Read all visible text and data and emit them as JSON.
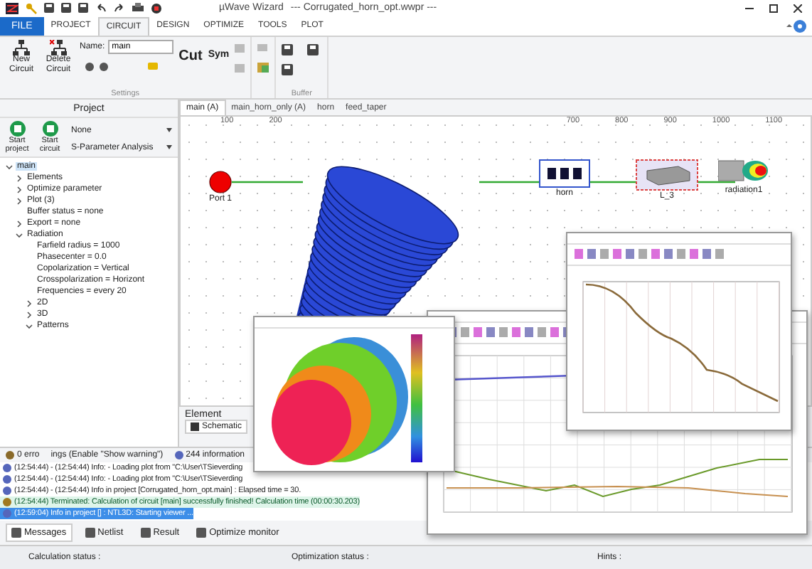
{
  "window": {
    "title": "µWave Wizard",
    "file": "--- Corrugated_horn_opt.wwpr ---"
  },
  "file_tab": "FILE",
  "ribbon_tabs": [
    {
      "label": "PROJECT",
      "selected": false
    },
    {
      "label": "CIRCUIT",
      "selected": true
    },
    {
      "label": "DESIGN",
      "selected": false
    },
    {
      "label": "OPTIMIZE",
      "selected": false
    },
    {
      "label": "TOOLS",
      "selected": false
    },
    {
      "label": "PLOT",
      "selected": false
    }
  ],
  "ribbon": {
    "new_button": "New Circuit",
    "delete_button": "Delete Circuit",
    "name_label": "Name:",
    "name_value": "main",
    "cut_button": "Cut",
    "sym_button": "Sym",
    "groups": [
      "Settings",
      "Buffer"
    ]
  },
  "project": {
    "title": "Project",
    "start_project": "Start project",
    "start_circuit": "Start circuit",
    "mode": "None",
    "analysis": "S-Parameter Analysis",
    "tree": [
      {
        "label": "main",
        "selected": true,
        "expanded": true,
        "children": [
          {
            "label": "Elements",
            "selected": false,
            "expanded": false
          },
          {
            "label": "Optimize parameter",
            "selected": false,
            "expanded": false
          },
          {
            "label": "Plot (3)",
            "selected": false,
            "expanded": false
          },
          {
            "label": "Buffer status = none",
            "selected": false
          },
          {
            "label": "Export = none",
            "selected": false,
            "expanded": false
          },
          {
            "label": "Radiation",
            "selected": false,
            "expanded": true,
            "children": [
              {
                "label": "Farfield radius = 1000",
                "selected": false
              },
              {
                "label": "Phasecenter = 0.0",
                "selected": false
              },
              {
                "label": "Copolarization = Vertical",
                "selected": false
              },
              {
                "label": "Crosspolarization = Horizont",
                "selected": false
              },
              {
                "label": "Frequencies = every 20",
                "selected": false
              },
              {
                "label": "2D",
                "selected": false,
                "expanded": false
              },
              {
                "label": "3D",
                "selected": false,
                "expanded": false
              },
              {
                "label": "Patterns",
                "selected": false,
                "expanded": true
              }
            ]
          }
        ]
      }
    ]
  },
  "doc_tabs": [
    {
      "label": "main (A)",
      "selected": true
    },
    {
      "label": "main_horn_only (A)",
      "selected": false
    },
    {
      "label": "horn",
      "selected": false
    },
    {
      "label": "feed_taper",
      "selected": false
    }
  ],
  "schematic": {
    "ruler_start": [
      "100",
      "200"
    ],
    "ruler_end": [
      "700",
      "800",
      "900",
      "1000",
      "1100"
    ],
    "parts": [
      {
        "kind": "port",
        "label": "Port 1"
      },
      {
        "kind": "block",
        "label": "horn"
      },
      {
        "kind": "box",
        "label": "L_3"
      },
      {
        "kind": "radiator",
        "label": "radiation1"
      }
    ]
  },
  "element_panel": {
    "title": "Element",
    "button": "Schematic"
  },
  "messages": {
    "errors": "0 erro",
    "warnings": "ings (Enable \"Show warning\")",
    "info": "244 information",
    "lines": [
      {
        "kind": "info",
        "selected": false,
        "text": "(12:54:44) - (12:54:44)  Info:    - Loading plot from \"C:\\User\\TSieverding"
      },
      {
        "kind": "info",
        "selected": false,
        "text": "(12:54:44) - (12:54:44)  Info:    - Loading plot from \"C:\\User\\TSieverding"
      },
      {
        "kind": "info",
        "selected": false,
        "text": "(12:54:44) - (12:54:44)  Info in project [Corrugated_horn_opt.main] : Elapsed time = 30."
      },
      {
        "kind": "done",
        "selected": false,
        "text": "(12:54:44) Terminated: Calculation of circuit [main] successfully finished!  Calculation time (00:00:30.203)"
      },
      {
        "kind": "info",
        "selected": true,
        "text": "(12:59:04) Info in project [] : NTL3D: Starting viewer ..."
      }
    ]
  },
  "bottom_tabs": [
    {
      "label": "Messages",
      "selected": true
    },
    {
      "label": "Netlist",
      "selected": false
    },
    {
      "label": "Result",
      "selected": false
    },
    {
      "label": "Optimize monitor",
      "selected": false
    }
  ],
  "status_bar": {
    "calculation": "Calculation status :",
    "optimization": "Optimization status :",
    "hints": "Hints :"
  }
}
